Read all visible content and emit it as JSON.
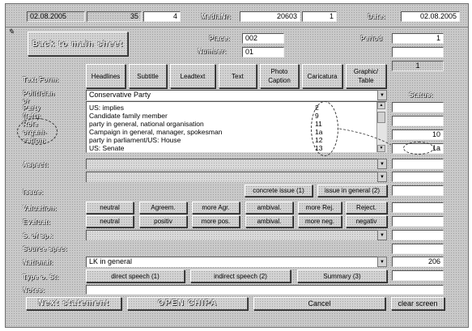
{
  "header": {
    "date1": "02.08.2005",
    "num1": "35",
    "num2": "4",
    "media_nr_label": "MediaNr:",
    "media_nr": "20603",
    "num3": "1",
    "date_label": "Date:",
    "date2": "02.08.2005"
  },
  "nav": {
    "back_label": "Back\nto main sheet"
  },
  "place": {
    "label": "Place:",
    "value": "002"
  },
  "number": {
    "label": "Number:",
    "value": "01"
  },
  "period": {
    "label": "Period",
    "value": "1"
  },
  "text_form": {
    "label": "Text Form:",
    "tabs": [
      "Headlines",
      "Subtitle",
      "Leadtext",
      "Text",
      "Photo\nCaption",
      "Caricatura",
      "Graphic/\nTable"
    ],
    "value": "1"
  },
  "politician": {
    "label": "Politician",
    "label2": "or",
    "value": "Conservative Party",
    "status_label": "Status:"
  },
  "party_list": {
    "labels": [
      "Party",
      "(left):",
      "Role",
      "organi-",
      "sation:"
    ],
    "rows": [
      {
        "text": "US: implies",
        "code": "2"
      },
      {
        "text": "Candidate family member",
        "code": "9"
      },
      {
        "text": "party in general, national organisation",
        "code": "11"
      },
      {
        "text": "Campaign in general, manager, spokesman",
        "code": "1a"
      },
      {
        "text": "party in parliament/US: House",
        "code": "12"
      },
      {
        "text": "US: Senate",
        "code": "13"
      }
    ],
    "value": "10",
    "value2": "1a"
  },
  "aspect": {
    "label": "Aspect:"
  },
  "issue": {
    "label": "Issue:",
    "concrete_label": "concrete issue (1)",
    "general_label": "issue in general (2)"
  },
  "valuation": {
    "label": "Valuation:",
    "buttons": [
      "neutral",
      "Agreem.",
      "more Agr.",
      "ambival.",
      "more Rej.",
      "Reject."
    ]
  },
  "evaluation": {
    "label": "Evaluat:",
    "buttons": [
      "neutral",
      "positiv",
      "more pos.",
      "ambival.",
      "more neg.",
      "negativ"
    ]
  },
  "s_of_sp": {
    "label": "S. of sp.:"
  },
  "source_spec": {
    "label": "Source spec:"
  },
  "national": {
    "label": "National:",
    "value": "LK in general",
    "code": "206"
  },
  "type_of_st": {
    "label": "Type o. St:",
    "buttons": [
      "direct speech (1)",
      "indirect speech (2)",
      "Summary (3)"
    ]
  },
  "notes": {
    "label": "Notes:"
  },
  "footer": {
    "next_label": "Next statement",
    "open_label": "OPEN CHIPA",
    "cancel_label": "Cancel",
    "clear_label": "clear screen"
  },
  "colors": {
    "panel": "#c9c9c9",
    "field": "#ffffff",
    "text": "#000000"
  }
}
